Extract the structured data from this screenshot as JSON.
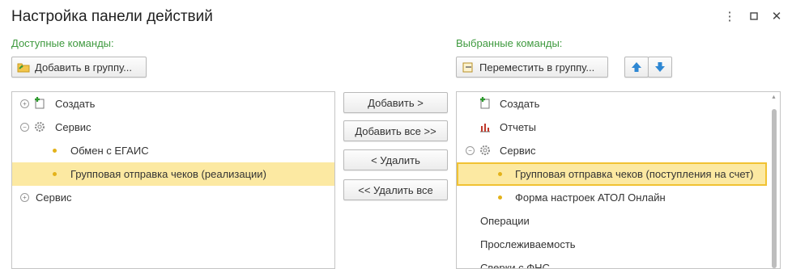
{
  "window": {
    "title": "Настройка панели действий",
    "controls": [
      "more-icon",
      "maximize-icon",
      "close-icon"
    ]
  },
  "available": {
    "label": "Доступные команды:",
    "add_to_group_button": "Добавить в группу...",
    "tree": [
      {
        "label": "Создать",
        "icon": "create-plus-icon",
        "expander": "plus"
      },
      {
        "label": "Сервис",
        "icon": "gear-icon",
        "expander": "minus"
      },
      {
        "label": "Обмен с ЕГАИС",
        "icon": "dot"
      },
      {
        "label": "Групповая отправка чеков (реализации)",
        "icon": "dot",
        "selected": true
      },
      {
        "label": "Сервис",
        "expander": "plus"
      }
    ]
  },
  "actions": {
    "add": "Добавить >",
    "add_all": "Добавить все >>",
    "remove": "< Удалить",
    "remove_all": "<< Удалить все"
  },
  "selected": {
    "label": "Выбранные команды:",
    "move_to_group_button": "Переместить в группу...",
    "move_up_icon": "arrow-up-icon",
    "move_down_icon": "arrow-down-icon",
    "tree": [
      {
        "label": "Создать",
        "icon": "create-plus-icon"
      },
      {
        "label": "Отчеты",
        "icon": "reports-chart-icon"
      },
      {
        "label": "Сервис",
        "icon": "gear-icon",
        "expander": "minus"
      },
      {
        "label": "Групповая отправка чеков (поступления на счет)",
        "icon": "dot",
        "selected": true
      },
      {
        "label": "Форма настроек АТОЛ Онлайн",
        "icon": "dot"
      },
      {
        "label": "Операции"
      },
      {
        "label": "Прослеживаемость"
      },
      {
        "label": "Сверки с ФНС"
      }
    ]
  },
  "colors": {
    "section_label": "#3f9a3f",
    "selection": "#fce9a2",
    "selection_border": "#f1c232",
    "arrow_blue": "#2e87d3"
  }
}
